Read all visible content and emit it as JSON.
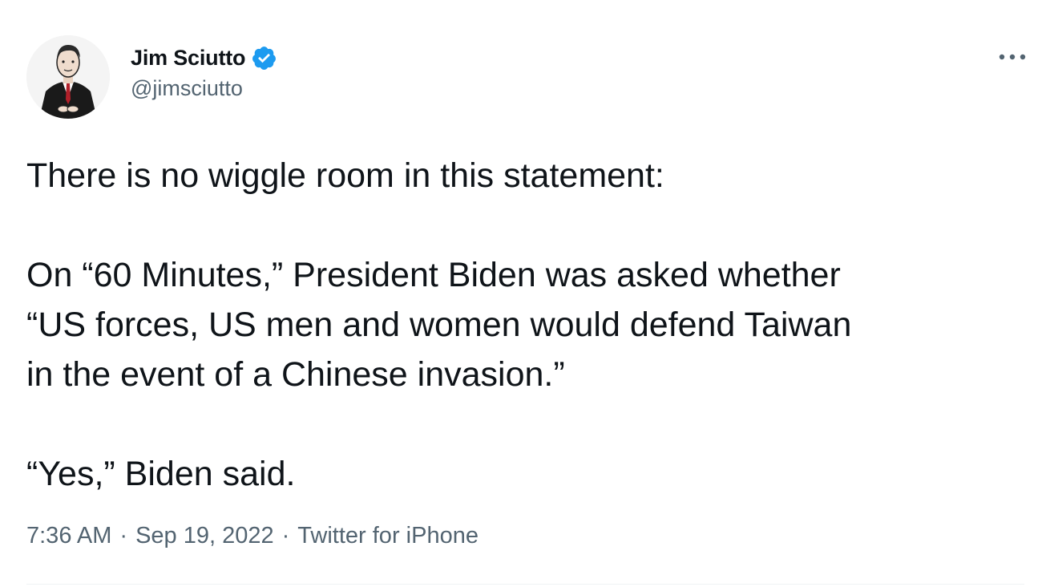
{
  "author": {
    "display_name": "Jim Sciutto",
    "handle": "@jimsciutto",
    "verified_icon": "verified-badge-icon",
    "verified_color": "#1d9bf0"
  },
  "tweet": {
    "lines": [
      "There is no wiggle room in this statement:",
      "",
      "On “60 Minutes,” President Biden was asked whether",
      "“US forces, US men and women would defend Taiwan",
      "in the event of a Chinese invasion.”",
      "",
      "“Yes,” Biden said."
    ]
  },
  "meta": {
    "time": "7:36 AM",
    "separator": "·",
    "date": "Sep 19, 2022",
    "source": "Twitter for iPhone"
  },
  "menu": {
    "icon": "more-options-icon"
  }
}
